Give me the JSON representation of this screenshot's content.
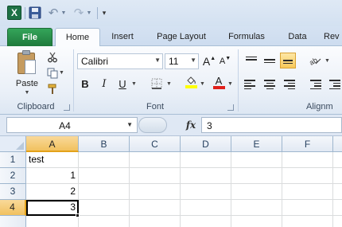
{
  "app": {
    "logo_letter": "X"
  },
  "quick_access": {
    "customize_glyph": "▾"
  },
  "tabs": [
    {
      "id": "file",
      "label": "File"
    },
    {
      "id": "home",
      "label": "Home"
    },
    {
      "id": "insert",
      "label": "Insert"
    },
    {
      "id": "page_layout",
      "label": "Page Layout"
    },
    {
      "id": "formulas",
      "label": "Formulas"
    },
    {
      "id": "data",
      "label": "Data"
    },
    {
      "id": "review",
      "label": "Rev"
    }
  ],
  "ribbon": {
    "clipboard": {
      "group_label": "Clipboard",
      "paste_label": "Paste"
    },
    "font": {
      "group_label": "Font",
      "font_name": "Calibri",
      "font_size": "11",
      "bold": "B",
      "italic": "I",
      "underline": "U",
      "font_color_letter": "A",
      "grow_font_letter": "A",
      "shrink_font_letter": "A"
    },
    "alignment": {
      "group_label": "Alignm"
    }
  },
  "formula_bar": {
    "name_box": "A4",
    "fx_label": "fx",
    "formula": "3"
  },
  "sheet": {
    "columns": [
      "A",
      "B",
      "C",
      "D",
      "E",
      "F"
    ],
    "rows": [
      "1",
      "2",
      "3",
      "4"
    ],
    "cells": {
      "A1": "test",
      "A2": "1",
      "A3": "2",
      "A4": "3"
    },
    "active_cell": "A4"
  },
  "colors": {
    "file_tab": "#1f7a3c",
    "selection_header": "#f1c15f",
    "highlight_fill": "#ffff00",
    "font_color": "#e0201b"
  }
}
